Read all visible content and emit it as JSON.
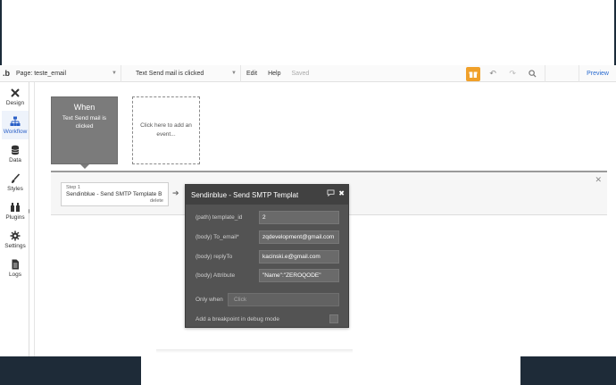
{
  "toolbar": {
    "logo": ".b",
    "page_select": "Page: teste_email",
    "event_select": "Text Send mail is clicked",
    "edit": "Edit",
    "help": "Help",
    "saved": "Saved",
    "preview": "Preview"
  },
  "sidebar": {
    "items": [
      {
        "label": "Design"
      },
      {
        "label": "Workflow"
      },
      {
        "label": "Data"
      },
      {
        "label": "Styles"
      },
      {
        "label": "Plugins"
      },
      {
        "label": "Settings"
      },
      {
        "label": "Logs"
      }
    ]
  },
  "workflow": {
    "event_when": "When",
    "event_name": "Text Send mail is clicked",
    "add_event": "Click here to add an event...",
    "step_number": "Step 1",
    "step_title": "Sendinblue - Send SMTP Template B",
    "step_delete": "delete"
  },
  "panel": {
    "title": "Sendinblue - Send SMTP Template",
    "fields": [
      {
        "label": "(path) template_id",
        "value": "2"
      },
      {
        "label": "(body) To_email*",
        "value": "zqdevelopment@gmail.com"
      },
      {
        "label": "(body) replyTo",
        "value": "kacinski.e@gmail.com"
      },
      {
        "label": "(body) Attribute",
        "value": "\"Name\":\"ZEROQODE\""
      }
    ],
    "only_when_label": "Only when",
    "only_when_placeholder": "Click",
    "breakpoint_label": "Add a breakpoint in debug mode"
  },
  "colors": {
    "accent": "#2a5fc7",
    "gift": "#f0a02a",
    "panel_bg": "#535353"
  }
}
